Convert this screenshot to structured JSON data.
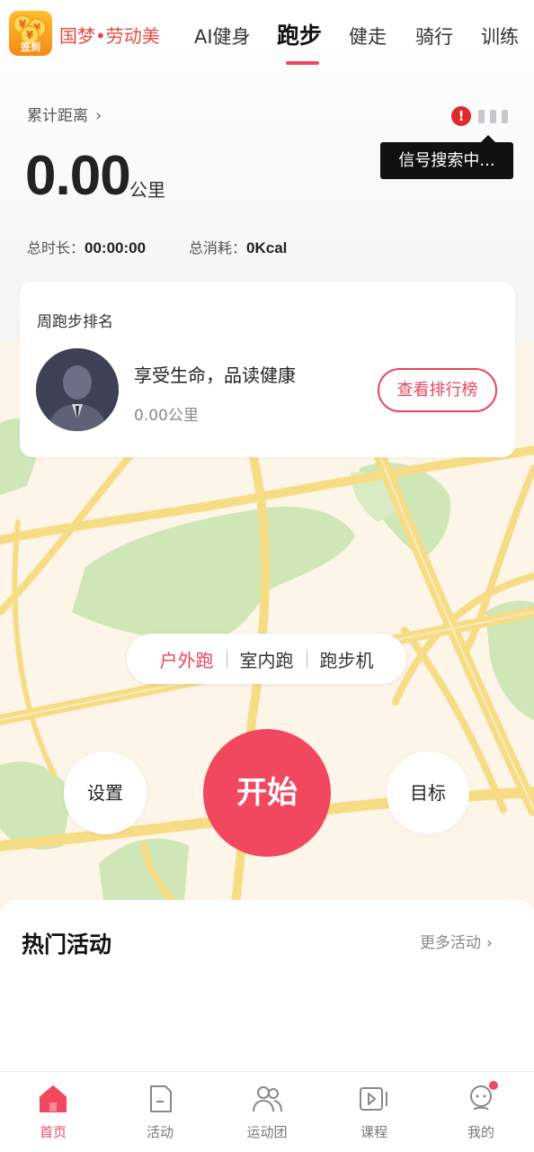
{
  "header": {
    "signin_badge": "签到",
    "brand": "国梦•劳动美",
    "tabs": [
      {
        "label": "AI健身",
        "active": false
      },
      {
        "label": "跑步",
        "active": true
      },
      {
        "label": "健走",
        "active": false
      },
      {
        "label": "骑行",
        "active": false
      },
      {
        "label": "训练",
        "active": false
      }
    ]
  },
  "stats": {
    "cumulative_label": "累计距离",
    "distance": "0.00",
    "distance_unit": "公里",
    "total_duration_label": "总时长：",
    "total_duration": "00:00:00",
    "total_calories_label": "总消耗：",
    "total_calories": "0Kcal"
  },
  "signal": {
    "alert": "!",
    "tooltip": "信号搜索中..."
  },
  "ranking": {
    "title": "周跑步排名",
    "name": "享受生命，品读健康",
    "distance": "0.00公里",
    "button": "查看排行榜"
  },
  "modes": [
    {
      "label": "户外跑",
      "active": true
    },
    {
      "label": "室内跑",
      "active": false
    },
    {
      "label": "跑步机",
      "active": false
    }
  ],
  "actions": {
    "settings": "设置",
    "start": "开始",
    "goal": "目标"
  },
  "hot": {
    "title": "热门活动",
    "more": "更多活动"
  },
  "nav": [
    {
      "label": "首页",
      "icon": "home-icon",
      "active": true
    },
    {
      "label": "活动",
      "icon": "document-icon",
      "active": false
    },
    {
      "label": "运动团",
      "icon": "group-icon",
      "active": false
    },
    {
      "label": "课程",
      "icon": "video-icon",
      "active": false
    },
    {
      "label": "我的",
      "icon": "profile-icon",
      "active": false
    }
  ],
  "colors": {
    "accent": "#f2485f",
    "brand": "#e44b43",
    "map_road": "#f7dc86",
    "map_park": "#cfe6b6",
    "map_base": "#fdf5e8"
  }
}
